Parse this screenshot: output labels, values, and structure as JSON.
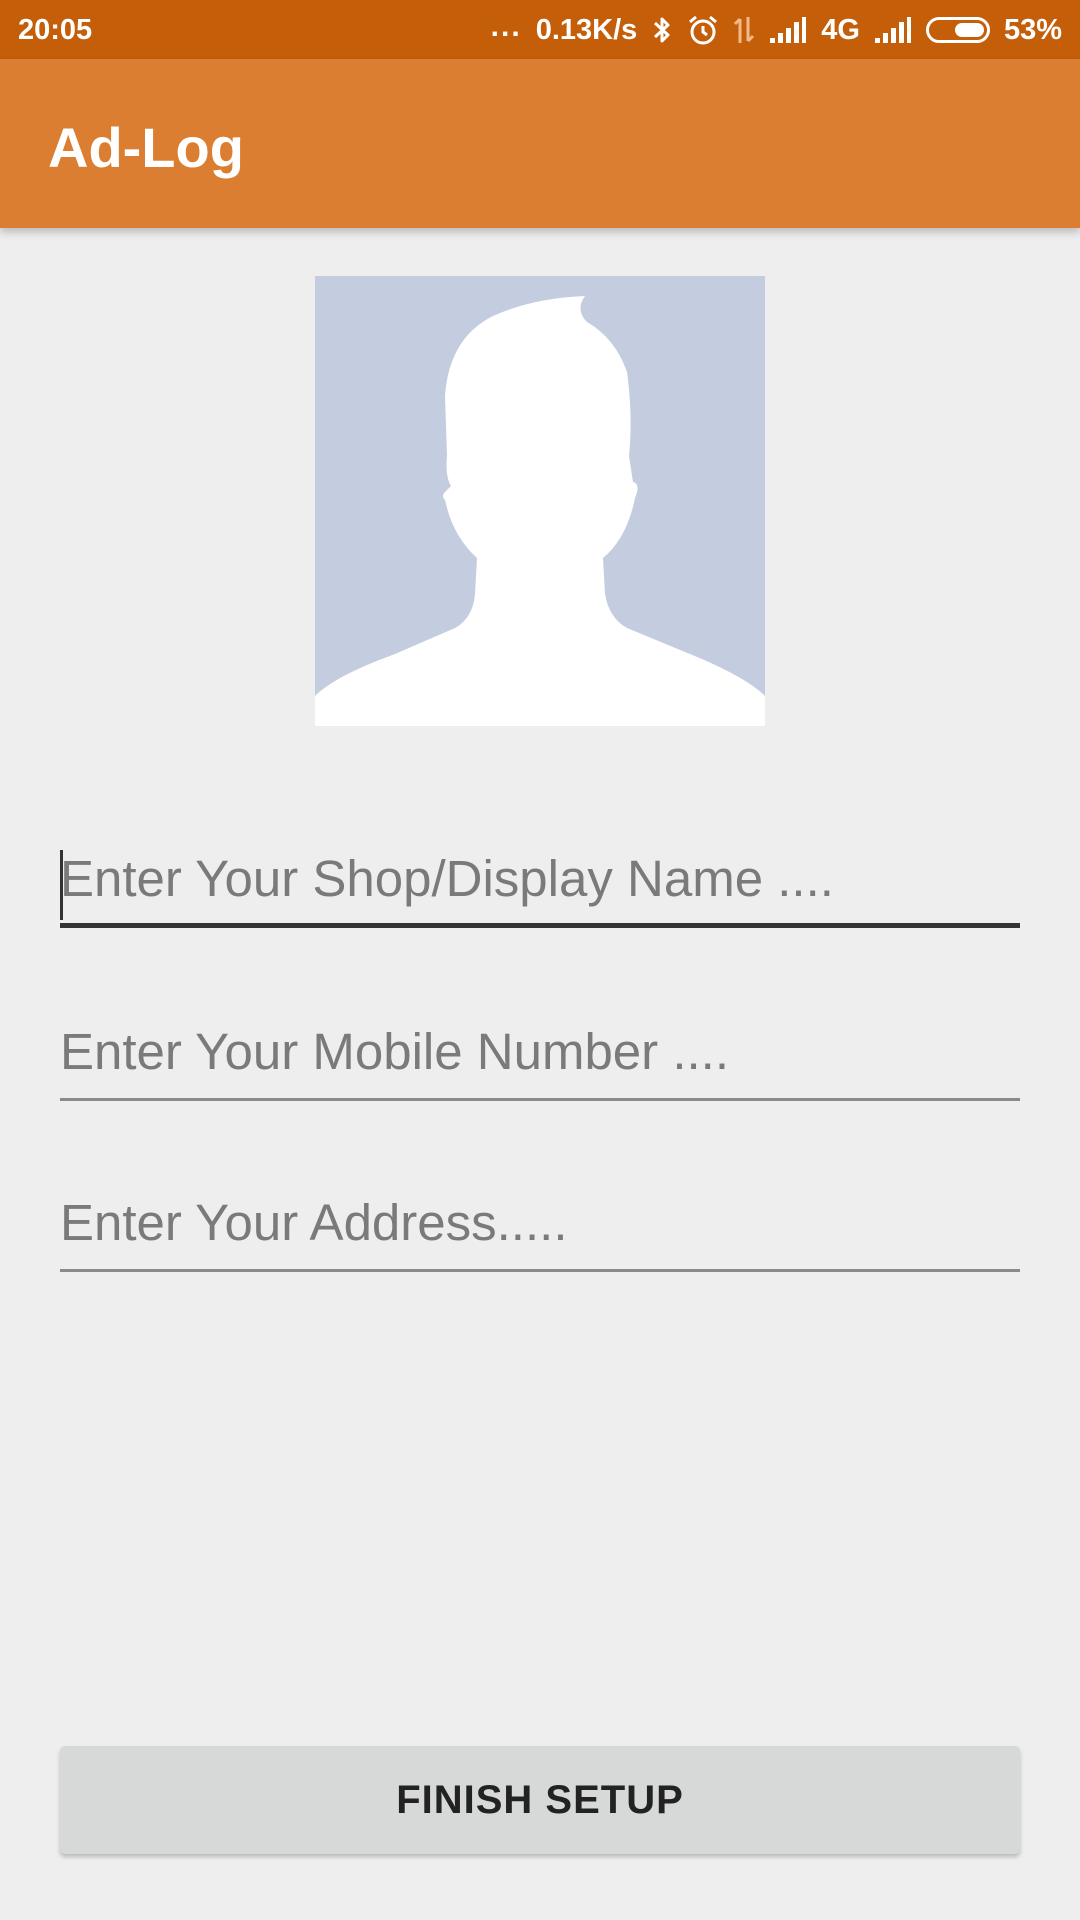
{
  "status_bar": {
    "time": "20:05",
    "dots": "...",
    "network_speed": "0.13K/s",
    "network_type": "4G",
    "battery_percent": "53%",
    "battery_level": 0.53,
    "icons": [
      "bluetooth-icon",
      "alarm-icon",
      "data-transfer-icon",
      "signal-icon",
      "signal-icon",
      "battery-icon"
    ],
    "color": "#c55e09"
  },
  "app_bar": {
    "title": "Ad-Log",
    "color": "#db7e31"
  },
  "avatar": {
    "icon": "profile-placeholder-icon",
    "background": "#c4ccdf"
  },
  "form": {
    "shop_name": {
      "value": "",
      "placeholder": "Enter Your Shop/Display Name ...."
    },
    "mobile_number": {
      "value": "",
      "placeholder": "Enter Your Mobile Number ...."
    },
    "address": {
      "value": "",
      "placeholder": "Enter Your Address....."
    }
  },
  "finish_button": {
    "label": "FINISH SETUP"
  }
}
